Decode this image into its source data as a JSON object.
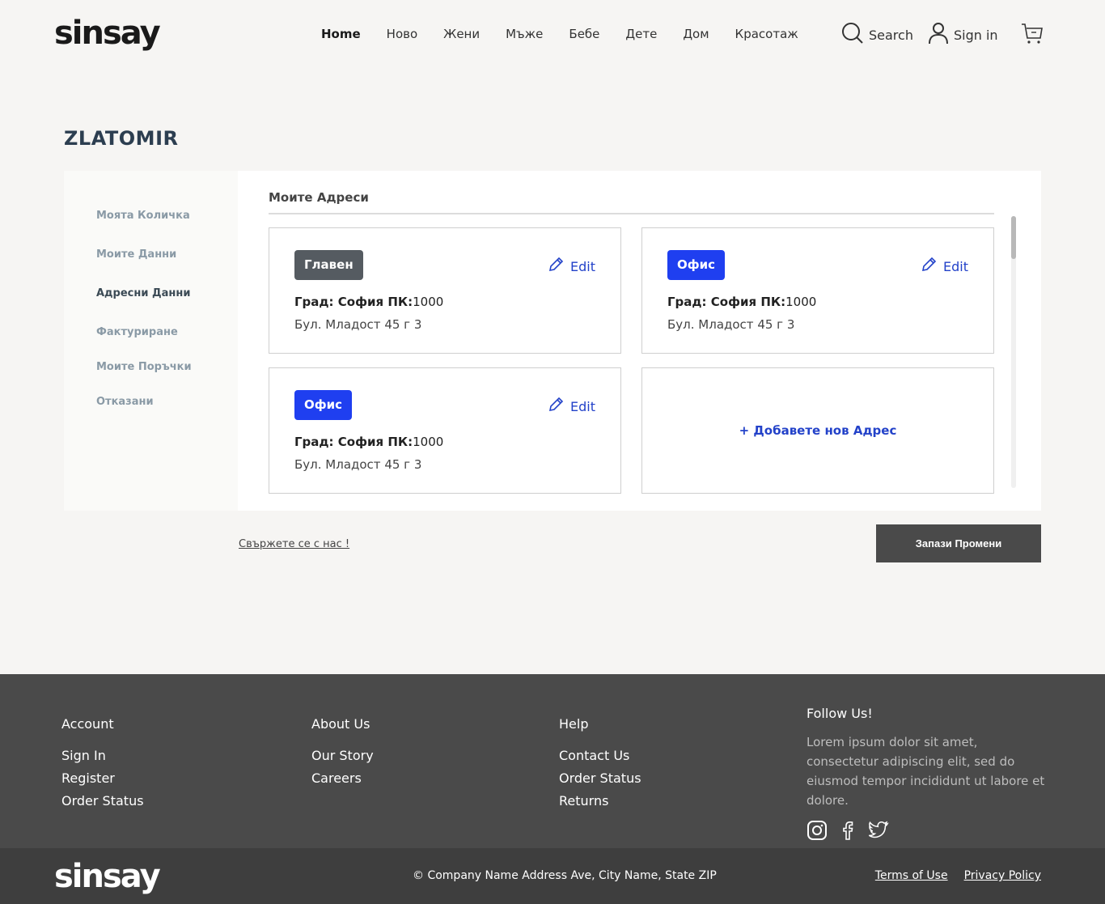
{
  "brand": {
    "logo_text": "sinsay"
  },
  "nav": {
    "items": [
      {
        "label": "Home",
        "active": true
      },
      {
        "label": "Ново"
      },
      {
        "label": "Жени"
      },
      {
        "label": "Мъже"
      },
      {
        "label": "Бебе"
      },
      {
        "label": "Дете"
      },
      {
        "label": "Дом"
      },
      {
        "label": "Красотаж"
      }
    ],
    "search_label": "Search",
    "signin_label": "Sign in"
  },
  "page": {
    "title": "ZLATOMIR"
  },
  "sidebar": {
    "items": [
      {
        "label": "Моята Количка"
      },
      {
        "label": "Моите Данни"
      },
      {
        "label": "Адресни Данни",
        "active": true
      },
      {
        "label": "Фактуриране"
      },
      {
        "label": "Моите Поръчки"
      },
      {
        "label": "Отказани"
      }
    ]
  },
  "addresses": {
    "section_title": "Моите Адреси",
    "edit_label": "Edit",
    "cards": [
      {
        "badge": "Главен",
        "city_label": "Град: София ПК:",
        "postcode": "1000",
        "street": "Бул. Младост 45 г 3"
      },
      {
        "badge": "Офис",
        "city_label": "Град: София ПК:",
        "postcode": "1000",
        "street": "Бул. Младост 45 г 3"
      },
      {
        "badge": "Офис",
        "city_label": "Град: София ПК:",
        "postcode": "1000",
        "street": "Бул. Младост 45 г 3"
      }
    ],
    "add_new_label": "+ Добавете нов Адрес"
  },
  "actions": {
    "contact_link": "Свържете се с нас !",
    "save_label": "Запази Промени"
  },
  "footer": {
    "account": {
      "title": "Account",
      "links": [
        "Sign In",
        "Register",
        "Order Status"
      ]
    },
    "about": {
      "title": "About Us",
      "links": [
        "Our Story",
        "Careers"
      ]
    },
    "help": {
      "title": "Help",
      "links": [
        "Contact Us",
        "Order Status",
        "Returns"
      ]
    },
    "follow": {
      "title": "Follow Us!",
      "text": "Lorem ipsum dolor sit amet, consectetur adipiscing elit, sed do eiusmod tempor incididunt ut labore et dolore."
    },
    "copyright": "© Company Name Address Ave, City Name, State ZIP",
    "terms": "Terms of Use",
    "privacy": "Privacy Policy"
  },
  "colors": {
    "accent_blue": "#1f3ff0",
    "badge_dark": "#555b61",
    "footer_bg": "#4a4a4a"
  }
}
